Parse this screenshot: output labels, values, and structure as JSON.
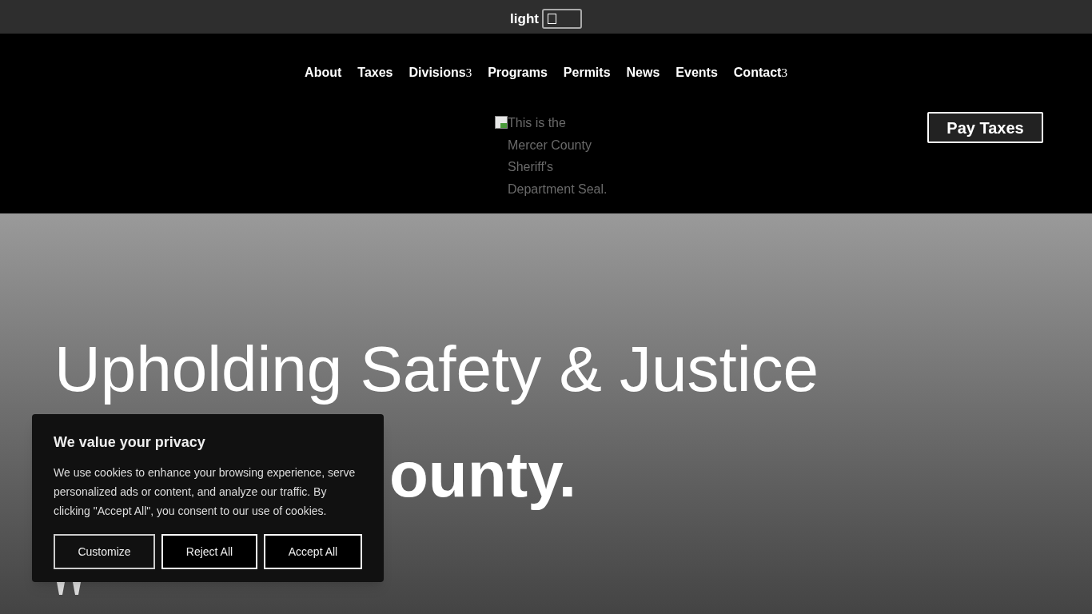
{
  "theme_toggle": {
    "label": "light",
    "on": false
  },
  "nav": {
    "items": [
      {
        "label": "About"
      },
      {
        "label": "Taxes"
      },
      {
        "label": "Divisions",
        "caret": "3"
      },
      {
        "label": "Programs"
      },
      {
        "label": "Permits"
      },
      {
        "label": "News"
      },
      {
        "label": "Events"
      },
      {
        "label": "Contact",
        "caret": "3"
      }
    ]
  },
  "logo": {
    "alt_text": "This is the Mercer County Sheriff's Department Seal."
  },
  "pay_button": "Pay Taxes",
  "hero": {
    "heading": "Upholding Safety & Justice",
    "heading_line_2": "ounty."
  },
  "cookie_banner": {
    "title": "We value your privacy",
    "text": "We use cookies to enhance your browsing experience, serve personalized ads or content, and analyze our traffic. By clicking \"Accept All\", you consent to our use of cookies.",
    "buttons": [
      {
        "label": "Customize",
        "kind": "outline"
      },
      {
        "label": "Reject All",
        "kind": "solid"
      },
      {
        "label": "Accept All",
        "kind": "solid"
      }
    ]
  }
}
